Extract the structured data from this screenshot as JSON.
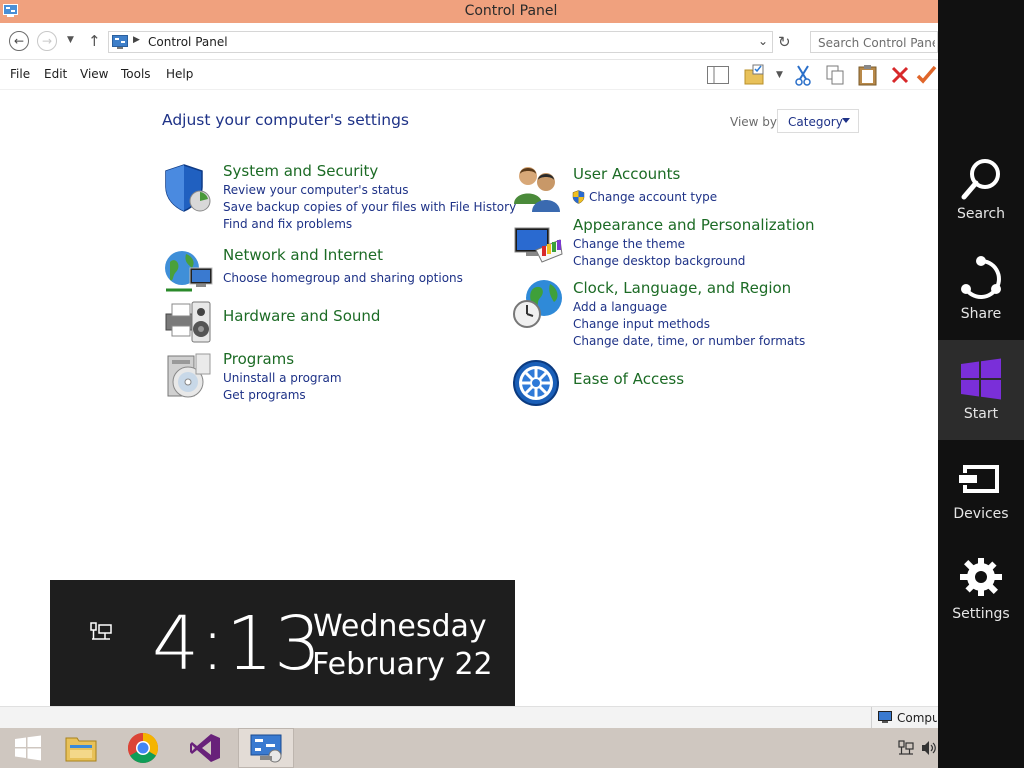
{
  "window": {
    "title": "Control Panel"
  },
  "address_bar": {
    "breadcrumb": "Control Panel",
    "search_placeholder": "Search Control Panel"
  },
  "menu": [
    "File",
    "Edit",
    "View",
    "Tools",
    "Help"
  ],
  "content": {
    "heading": "Adjust your computer's settings",
    "view_by_label": "View by:",
    "view_by_value": "Category",
    "left_categories": [
      {
        "title": "System and Security",
        "icon": "shield-icon",
        "links": [
          "Review your computer's status",
          "Save backup copies of your files with File History",
          "Find and fix problems"
        ]
      },
      {
        "title": "Network and Internet",
        "icon": "network-globe-icon",
        "links": [
          "Choose homegroup and sharing options"
        ]
      },
      {
        "title": "Hardware and Sound",
        "icon": "printer-speaker-icon",
        "links": []
      },
      {
        "title": "Programs",
        "icon": "programs-disc-icon",
        "links": [
          "Uninstall a program",
          "Get programs"
        ]
      }
    ],
    "right_categories": [
      {
        "title": "User Accounts",
        "icon": "users-icon",
        "links": [
          "Change account type"
        ]
      },
      {
        "title": "Appearance and Personalization",
        "icon": "monitor-palette-icon",
        "links": [
          "Change the theme",
          "Change desktop background"
        ]
      },
      {
        "title": "Clock, Language, and Region",
        "icon": "globe-clock-icon",
        "links": [
          "Add a language",
          "Change input methods",
          "Change date, time, or number formats"
        ]
      },
      {
        "title": "Ease of Access",
        "icon": "ease-of-access-icon",
        "links": []
      }
    ]
  },
  "clock_overlay": {
    "time": "4:13",
    "weekday": "Wednesday",
    "date": "February 22"
  },
  "status_bar": {
    "text": "Computer"
  },
  "taskbar": {
    "apps": [
      "start-icon",
      "file-explorer-icon",
      "chrome-icon",
      "visual-studio-icon",
      "control-panel-icon"
    ]
  },
  "charms": [
    {
      "label": "Search",
      "icon": "search-icon"
    },
    {
      "label": "Share",
      "icon": "share-icon"
    },
    {
      "label": "Start",
      "icon": "windows-logo-icon"
    },
    {
      "label": "Devices",
      "icon": "devices-icon"
    },
    {
      "label": "Settings",
      "icon": "gear-icon"
    }
  ],
  "colors": {
    "titlebar": "#f0a17e",
    "heading_blue": "#1e3287",
    "category_green": "#1c6b25",
    "charms_bg": "#111111",
    "start_accent": "#7a2fd9",
    "taskbar": "#cfc7c0"
  }
}
